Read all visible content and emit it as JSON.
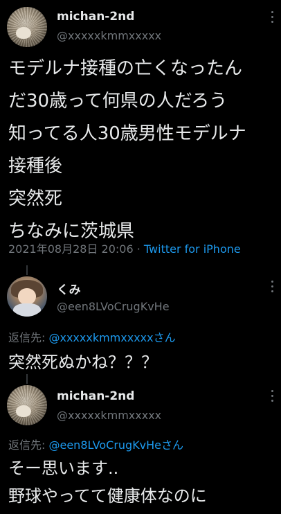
{
  "tweet": {
    "author_name": "michan-2nd",
    "author_handle": "@xxxxxkmmxxxxx",
    "lines": [
      "モデルナ接種の亡くなったん",
      "だ30歳って何県の人だろう",
      "知ってる人30歳男性モデルナ",
      "接種後",
      "突然死",
      "ちなみに茨城県"
    ],
    "timestamp": "2021年08月28日 20:06",
    "separator": " · ",
    "source": "Twitter for iPhone"
  },
  "replies": [
    {
      "author_name": "くみ",
      "author_handle": "@een8LVoCrugKvHe",
      "reply_to_label": "返信先: ",
      "reply_to_mention": "@xxxxxkmmxxxxxさん",
      "lines": [
        "突然死ぬかね？？？"
      ]
    },
    {
      "author_name": "michan-2nd",
      "author_handle": "@xxxxxkmmxxxxx",
      "reply_to_label": "返信先: ",
      "reply_to_mention": "@een8LVoCrugKvHeさん",
      "lines": [
        "そー思います..",
        "野球やってて健康体なのに"
      ]
    }
  ],
  "colors": {
    "background": "#000000",
    "text": "#e7e9ea",
    "secondary": "#71767b",
    "accent": "#1d9bf0"
  }
}
